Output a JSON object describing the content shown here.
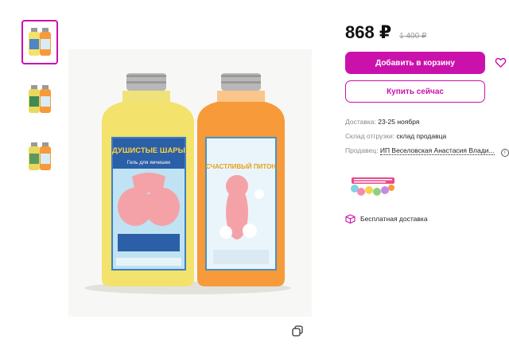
{
  "gallery": {
    "thumbnails": [
      {
        "name": "photo-1",
        "active": true
      },
      {
        "name": "photo-2",
        "active": false
      },
      {
        "name": "photo-3",
        "active": false
      }
    ]
  },
  "product_image": {
    "left_bottle": {
      "title": "ДУШИСТЫЕ ШАРЫ",
      "subtitle": "Гель для яичишек",
      "color": "#f3e26b"
    },
    "right_bottle": {
      "title": "СЧАСТЛИВЫЙ ПИТОН",
      "color": "#f79a3a"
    }
  },
  "price": {
    "current": "868 ₽",
    "old": "1 400 ₽"
  },
  "actions": {
    "add_to_cart": "Добавить в корзину",
    "buy_now": "Купить сейчас"
  },
  "details": {
    "delivery_label": "Доставка:",
    "delivery_value": "23-25 ноября",
    "warehouse_label": "Склад отгрузки:",
    "warehouse_value": "склад продавца",
    "seller_label": "Продавец:",
    "seller_value": "ИП Веселовская Анастасия Влади..."
  },
  "free_delivery": "Бесплатная доставка",
  "colors": {
    "accent": "#cb11ab"
  }
}
